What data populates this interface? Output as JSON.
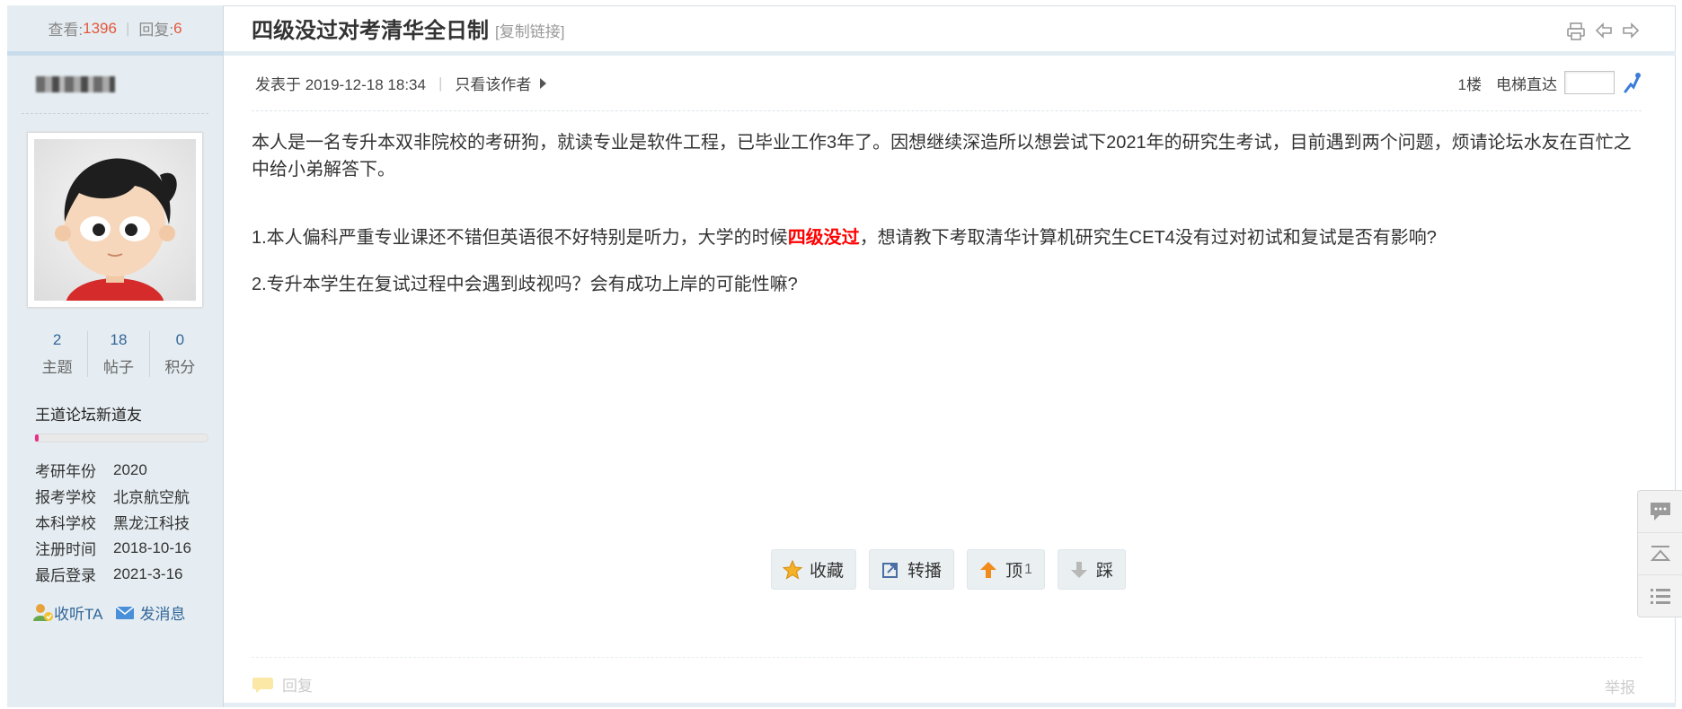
{
  "sidebar": {
    "views_label": "查看:",
    "views": "1396",
    "replies_label": "回复:",
    "replies": "6",
    "counts": [
      {
        "value": "2",
        "label": "主题"
      },
      {
        "value": "18",
        "label": "帖子"
      },
      {
        "value": "0",
        "label": "积分"
      }
    ],
    "rank": "王道论坛新道友",
    "rank_progress": 0.02,
    "info": [
      {
        "k": "考研年份",
        "v": "2020"
      },
      {
        "k": "报考学校",
        "v": "北京航空航"
      },
      {
        "k": "本科学校",
        "v": "黑龙江科技"
      },
      {
        "k": "注册时间",
        "v": "2018-10-16"
      },
      {
        "k": "最后登录",
        "v": "2021-3-16"
      }
    ],
    "follow": "收听TA",
    "message": "发消息"
  },
  "post": {
    "title": "四级没过对考清华全日制",
    "copy_link": "[复制链接]",
    "posted": "发表于 2019-12-18 18:34",
    "only_author": "只看该作者",
    "floor": "1楼",
    "elevator": "电梯直达",
    "p1": "本人是一名专升本双非院校的考研狗，就读专业是软件工程，已毕业工作3年了。因想继续深造所以想尝试下2021年的研究生考试，目前遇到两个问题，烦请论坛水友在百忙之中给小弟解答下。",
    "p2_a": "1.本人偏科严重专业课还不错但英语很不好特别是听力，大学的时候",
    "p2_hl": "四级没过",
    "p2_b": "，想请教下考取清华计算机研究生CET4没有过对初试和复试是否有影响?",
    "p3": "2.专升本学生在复试过程中会遇到歧视吗？会有成功上岸的可能性嘛?"
  },
  "buttons": {
    "favorite": "收藏",
    "share": "转播",
    "up": "顶",
    "up_count": "1",
    "down": "踩"
  },
  "footer": {
    "reply": "回复",
    "report": "举报"
  },
  "colors": {
    "accent_red": "#e4573b",
    "link_blue": "#336699",
    "sidebar_bg": "#e5edf2"
  }
}
